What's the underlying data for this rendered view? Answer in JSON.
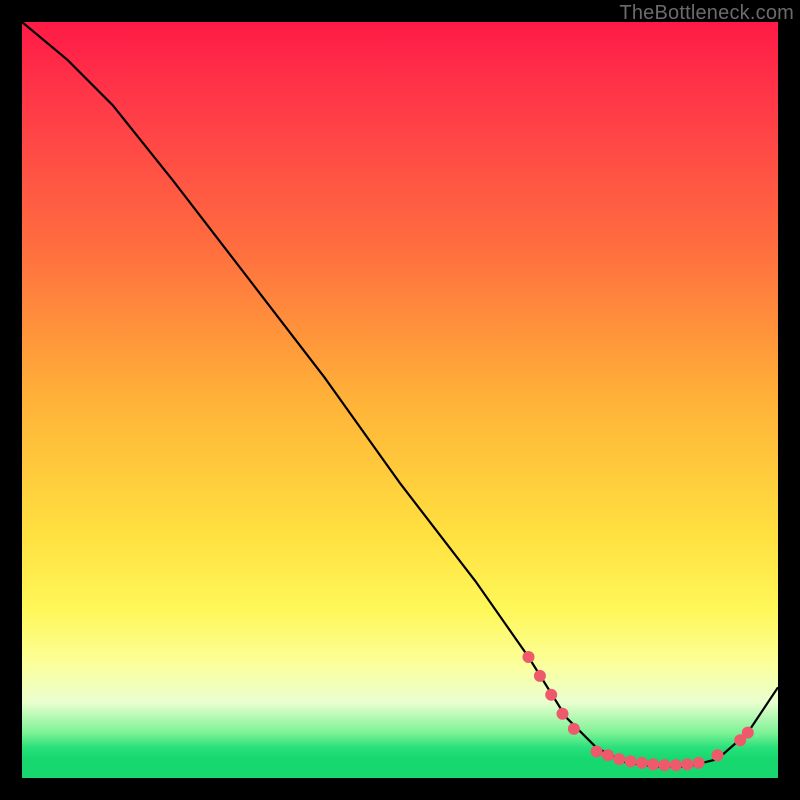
{
  "watermark": "TheBottleneck.com",
  "chart_data": {
    "type": "line",
    "title": "",
    "xlabel": "",
    "ylabel": "",
    "xlim": [
      0,
      100
    ],
    "ylim": [
      0,
      100
    ],
    "grid": false,
    "legend": false,
    "series": [
      {
        "name": "curve",
        "x": [
          0,
          6,
          12,
          20,
          30,
          40,
          50,
          60,
          67,
          72,
          76,
          80,
          84,
          88,
          92,
          96,
          100
        ],
        "y": [
          100,
          95,
          89,
          79,
          66,
          53,
          39,
          26,
          16,
          8,
          4,
          2,
          1.5,
          1.5,
          2.5,
          6,
          12
        ]
      }
    ],
    "markers": [
      {
        "x": 67,
        "y": 16
      },
      {
        "x": 68.5,
        "y": 13.5
      },
      {
        "x": 70,
        "y": 11
      },
      {
        "x": 71.5,
        "y": 8.5
      },
      {
        "x": 73,
        "y": 6.5
      },
      {
        "x": 76,
        "y": 3.5
      },
      {
        "x": 77.5,
        "y": 3
      },
      {
        "x": 79,
        "y": 2.5
      },
      {
        "x": 80.5,
        "y": 2.2
      },
      {
        "x": 82,
        "y": 2
      },
      {
        "x": 83.5,
        "y": 1.8
      },
      {
        "x": 85,
        "y": 1.7
      },
      {
        "x": 86.5,
        "y": 1.7
      },
      {
        "x": 88,
        "y": 1.8
      },
      {
        "x": 89.5,
        "y": 2
      },
      {
        "x": 92,
        "y": 3
      },
      {
        "x": 95,
        "y": 5
      },
      {
        "x": 96,
        "y": 6
      }
    ],
    "marker_radius_px": 6
  },
  "colors": {
    "background": "#000000",
    "curve": "#000000",
    "marker": "#ec5a6b"
  }
}
